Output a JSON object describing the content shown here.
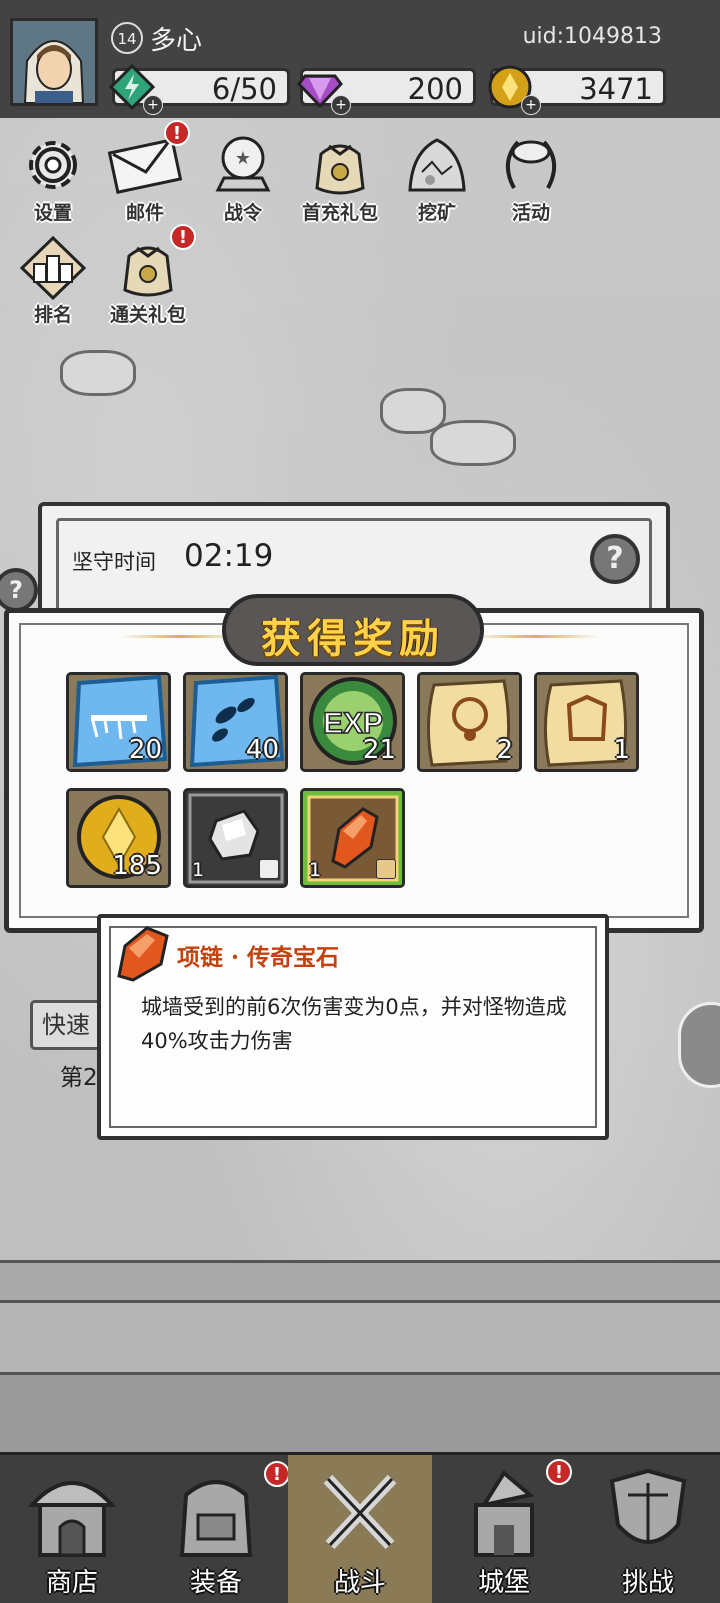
{
  "player": {
    "level": "14",
    "name": "多心",
    "uid": "uid:1049813"
  },
  "resources": [
    {
      "name": "energy",
      "icon": "lightning-gem-icon",
      "value": "6/50",
      "color": "#2fa37a"
    },
    {
      "name": "gems",
      "icon": "diamond-icon",
      "value": "200",
      "color": "#a64cc7"
    },
    {
      "name": "gold",
      "icon": "gold-coin-icon",
      "value": "3471",
      "color": "#d4a017"
    }
  ],
  "menu": {
    "settings": "设置",
    "mail": "邮件",
    "battle_pass": "战令",
    "first_recharge": "首充礼包",
    "mining": "挖矿",
    "events": "活动",
    "ranking": "排名",
    "clear_pack": "通关礼包"
  },
  "alert_mark": "!",
  "timer": {
    "label": "坚守时间",
    "value": "02:19"
  },
  "help_mark": "?",
  "reward": {
    "title": "获得奖励",
    "items": [
      {
        "icon": "ice-skill-scroll-icon",
        "qty": "20"
      },
      {
        "icon": "ice-shards-skill-icon",
        "qty": "40"
      },
      {
        "icon": "exp-orb-icon",
        "label": "EXP",
        "qty": "21"
      },
      {
        "icon": "necklace-blueprint-icon",
        "qty": "2"
      },
      {
        "icon": "armor-blueprint-icon",
        "qty": "1"
      },
      {
        "icon": "gold-coin-icon",
        "qty": "185"
      },
      {
        "icon": "silver-ore-icon",
        "qty": "1"
      },
      {
        "icon": "orange-gem-icon",
        "qty": "1"
      }
    ]
  },
  "tooltip": {
    "title": "项链 · 传奇宝石",
    "description": "城墙受到的前6次伤害变为0点，并对怪物造成40%攻击力伤害"
  },
  "quick_button": "快速",
  "stage_text": "第2",
  "nav": {
    "shop": "商店",
    "equipment": "装备",
    "battle": "战斗",
    "castle": "城堡",
    "challenge": "挑战"
  }
}
